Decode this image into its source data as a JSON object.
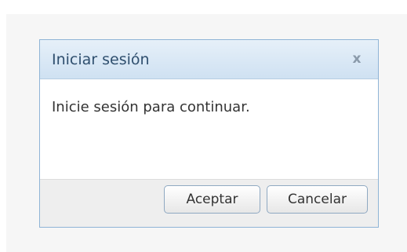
{
  "dialog": {
    "title": "Iniciar sesión",
    "close_label": "x",
    "message": "Inicie sesión para continuar.",
    "buttons": {
      "ok_label": "Aceptar",
      "cancel_label": "Cancelar"
    }
  },
  "colors": {
    "titlebar": "#cfe1f2",
    "border": "#8fb4d6",
    "footer": "#eeeeee"
  }
}
